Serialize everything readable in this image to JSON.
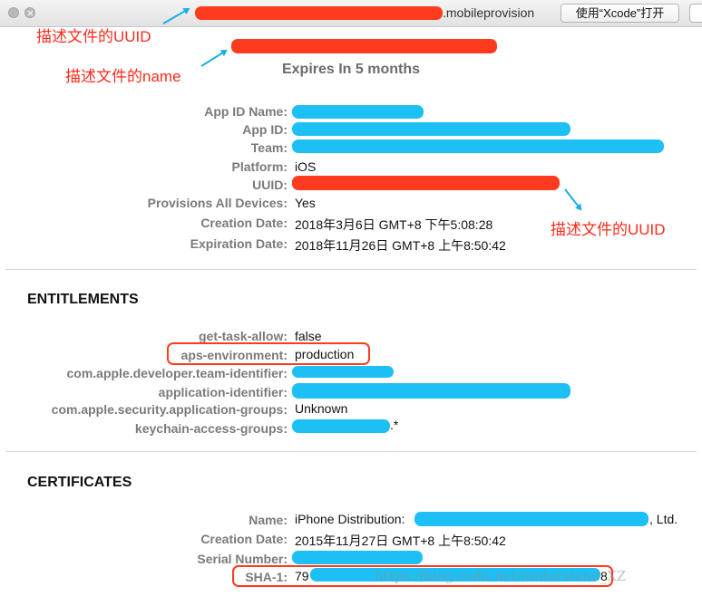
{
  "window": {
    "title_suffix": ".mobileprovision",
    "open_button_label": "使用“Xcode”打开"
  },
  "annotations": {
    "uuid_top": "描述文件的UUID",
    "name": "描述文件的name",
    "uuid_right": "描述文件的UUID"
  },
  "profile": {
    "expires": "Expires In 5 months"
  },
  "info": {
    "app_id_name_label": "App ID Name:",
    "app_id_label": "App ID:",
    "team_label": "Team:",
    "platform_label": "Platform:",
    "platform_value": "iOS",
    "uuid_label": "UUID:",
    "provisions_all_label": "Provisions All Devices:",
    "provisions_all_value": "Yes",
    "creation_date_label": "Creation Date:",
    "creation_date_value": "2018年3月6日 GMT+8 下午5:08:28",
    "expiration_date_label": "Expiration Date:",
    "expiration_date_value": "2018年11月26日 GMT+8 上午8:50:42"
  },
  "entitlements": {
    "title": "ENTITLEMENTS",
    "get_task_allow_label": "get-task-allow:",
    "get_task_allow_value": "false",
    "aps_env_label": "aps-environment:",
    "aps_env_value": "production",
    "team_identifier_label": "com.apple.developer.team-identifier:",
    "application_identifier_label": "application-identifier:",
    "security_groups_label": "com.apple.security.application-groups:",
    "security_groups_value": "Unknown",
    "keychain_label": "keychain-access-groups:",
    "keychain_suffix": ".*"
  },
  "certificates": {
    "title": "CERTIFICATES",
    "name_label": "Name:",
    "name_prefix": "iPhone Distribution:",
    "name_suffix": ", Ltd.",
    "creation_date_label": "Creation Date:",
    "creation_date_value": "2015年11月27日 GMT+8 上午8:50:42",
    "serial_label": "Serial Number:",
    "sha1_label": "SHA-1:",
    "sha1_prefix": "79",
    "sha1_suffix": "8"
  },
  "watermark": "https://blog.csdn.net/understand_XZ",
  "colors": {
    "redaction_red": "#ff3b1f",
    "redaction_blue": "#1cc0f4",
    "annotation_red": "#ff2a1a",
    "arrow_blue": "#1aaee8"
  }
}
